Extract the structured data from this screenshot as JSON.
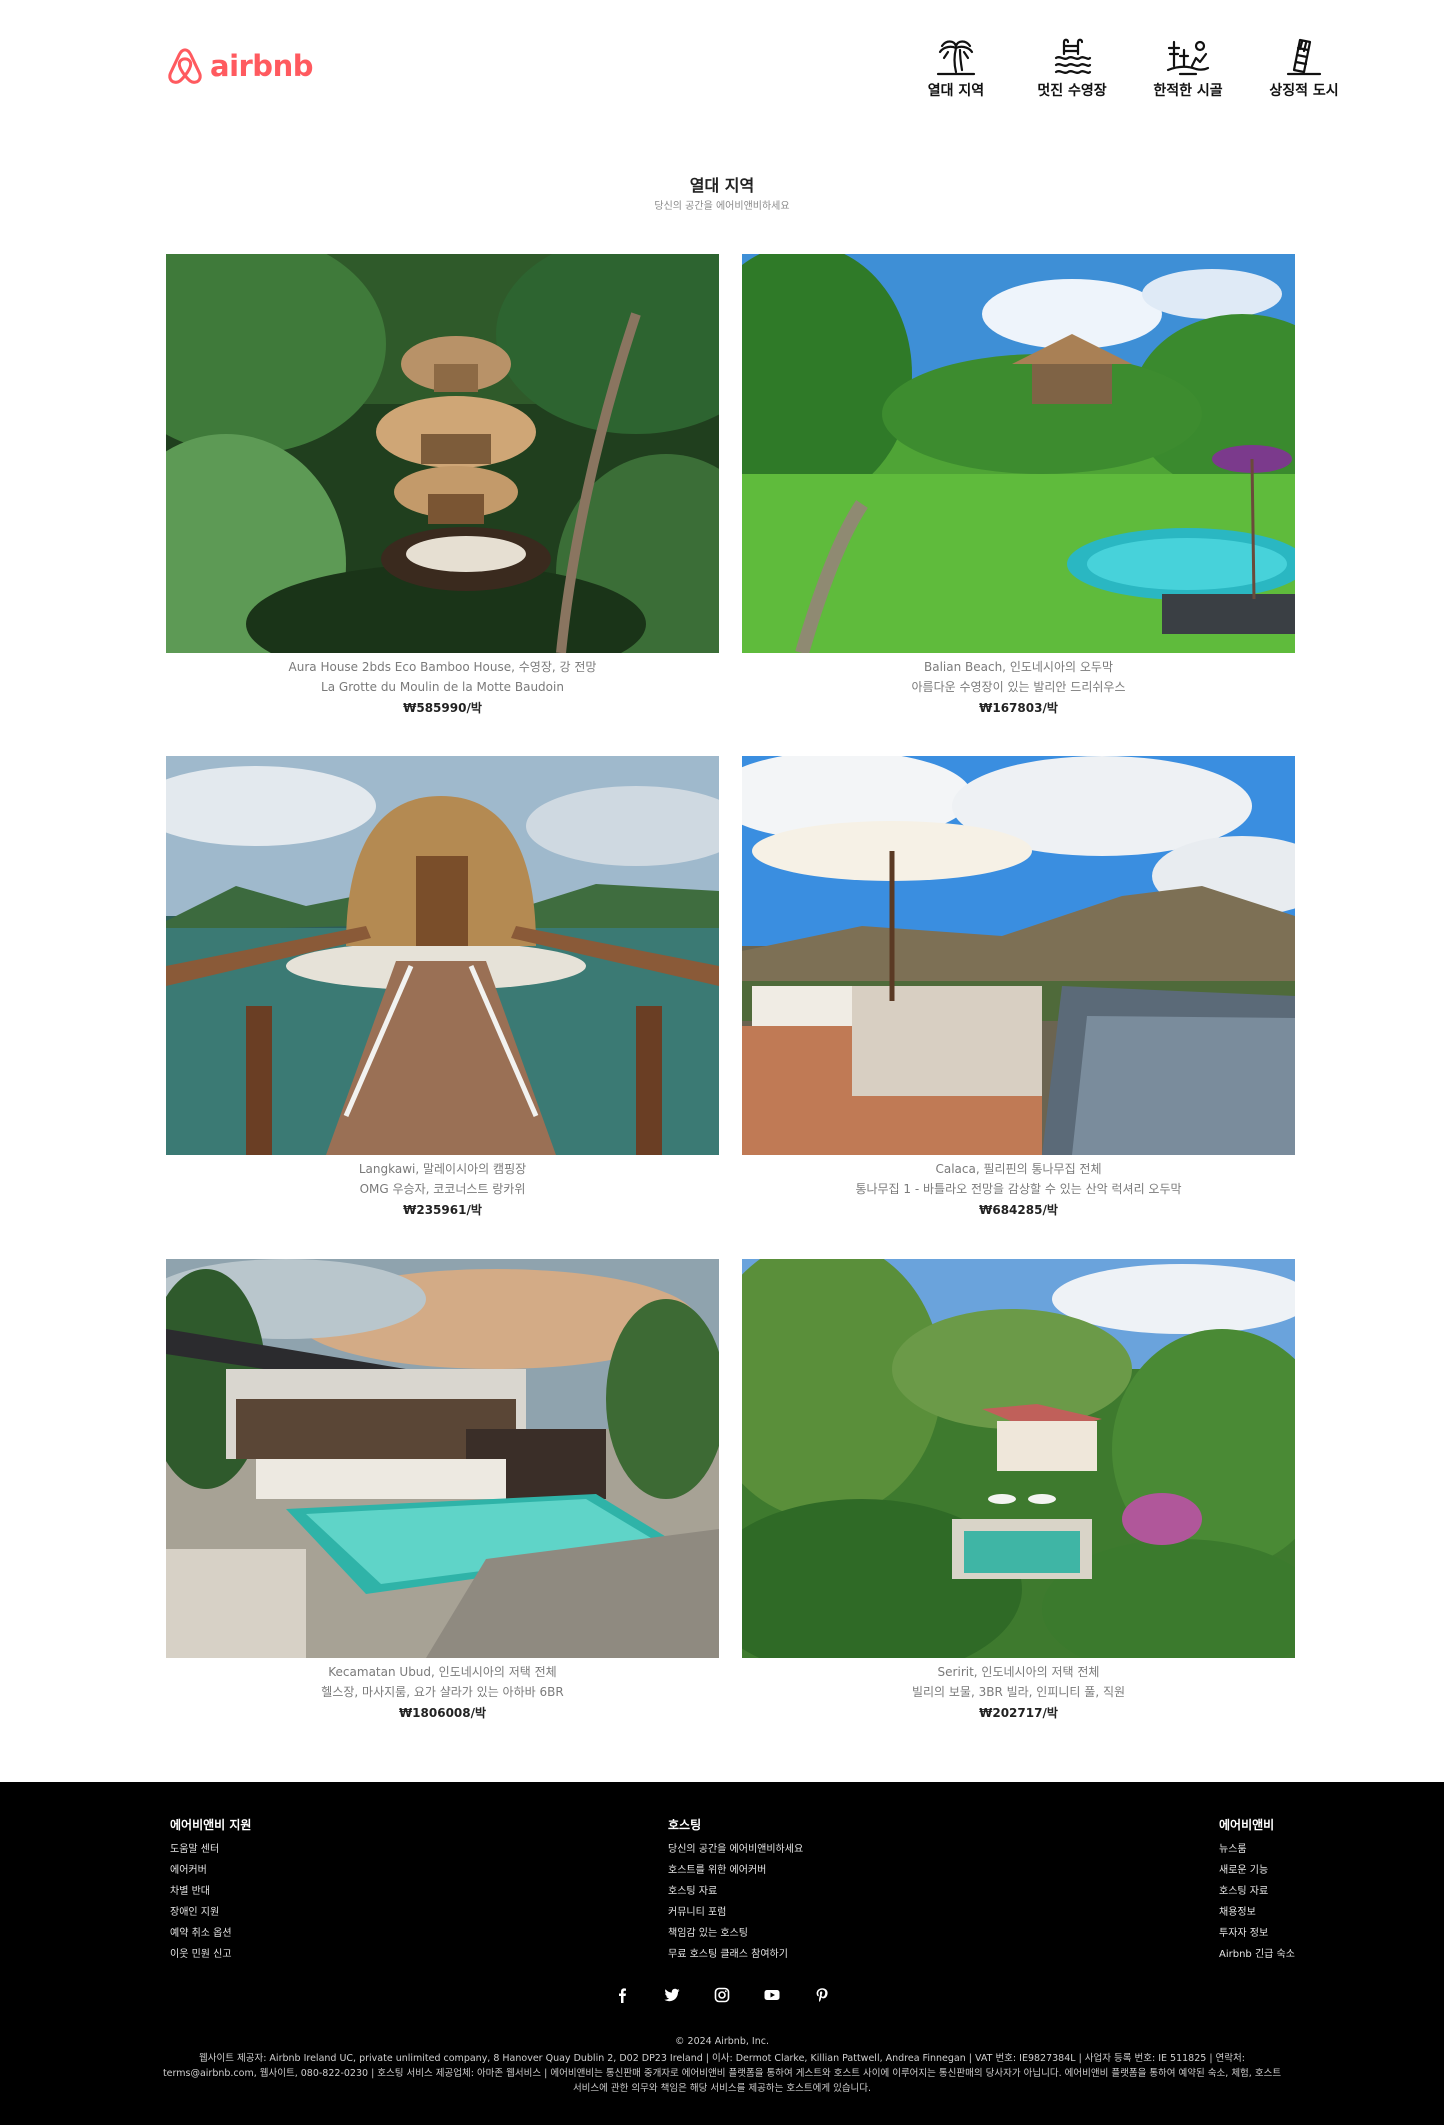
{
  "brand": {
    "name": "airbnb",
    "color": "#FF5A5F"
  },
  "categories": [
    {
      "label": "열대 지역",
      "icon": "palm-tree-icon"
    },
    {
      "label": "멋진 수영장",
      "icon": "pool-icon"
    },
    {
      "label": "한적한 시골",
      "icon": "countryside-icon"
    },
    {
      "label": "상징적 도시",
      "icon": "leaning-tower-icon"
    }
  ],
  "section": {
    "title": "열대 지역",
    "subtitle": "당신의 공간을 에어비앤비하세요"
  },
  "listings": [
    {
      "location": "Aura House 2bds Eco Bamboo House, 수영장, 강 전망",
      "name": "La Grotte du Moulin de la Motte Baudoin",
      "price": "₩585990/박",
      "image": "bamboo-treehouse-jungle-photo"
    },
    {
      "location": "Balian Beach, 인도네시아의 오두막",
      "name": "아름다운 수영장이 있는 발리안 드리쉬우스",
      "price": "₩167803/박",
      "image": "garden-hut-pool-photo"
    },
    {
      "location": "Langkawi, 말레이시아의 캠핑장",
      "name": "OMG 우승자, 코코너스트 랑카위",
      "price": "₩235961/박",
      "image": "floating-coconut-hut-photo"
    },
    {
      "location": "Calaca, 필리핀의 통나무집 전체",
      "name": "통나무집 1 - 바틀라오 전망을 감상할 수 있는 산악 럭셔리 오두막",
      "price": "₩684285/박",
      "image": "mountain-view-deck-photo"
    },
    {
      "location": "Kecamatan Ubud, 인도네시아의 저택 전체",
      "name": "헬스장, 마사지룸, 요가 샬라가 있는 아하바 6BR",
      "price": "₩1806008/박",
      "image": "modern-villa-pool-photo"
    },
    {
      "location": "Seririt, 인도네시아의 저택 전체",
      "name": "빌리의 보물, 3BR 빌라, 인피니티 풀, 직원",
      "price": "₩202717/박",
      "image": "jungle-villa-aerial-photo"
    }
  ],
  "footer": {
    "columns": [
      {
        "title": "에어비앤비 지원",
        "links": [
          "도움말 센터",
          "에어커버",
          "차별 반대",
          "장애인 지원",
          "예약 취소 옵션",
          "이웃 민원 신고"
        ]
      },
      {
        "title": "호스팅",
        "links": [
          "당신의 공간을 에어비앤비하세요",
          "호스트를 위한 에어커버",
          "호스팅 자료",
          "커뮤니티 포럼",
          "책임감 있는 호스팅",
          "무료 호스팅 클래스 참여하기"
        ]
      },
      {
        "title": "에어비앤비",
        "links": [
          "뉴스룸",
          "새로운 기능",
          "호스팅 자료",
          "채용정보",
          "투자자 정보",
          "Airbnb 긴급 숙소"
        ]
      }
    ],
    "social": [
      "facebook-icon",
      "twitter-icon",
      "instagram-icon",
      "youtube-icon",
      "pinterest-icon"
    ],
    "copyright": "© 2024 Airbnb, Inc.",
    "legal": "웹사이트 제공자: Airbnb Ireland UC, private unlimited company, 8 Hanover Quay Dublin 2, D02 DP23 Ireland | 이사: Dermot Clarke, Killian Pattwell, Andrea Finnegan | VAT 번호: IE9827384L | 사업자 등록 번호: IE 511825 | 연락처: terms@airbnb.com, 웹사이트, 080-822-0230 | 호스팅 서비스 제공업체: 아마존 웹서비스 | 에어비앤비는 통신판매 중개자로 에어비앤비 플랫폼을 통하여 게스트와 호스트 사이에 이루어지는 통신판매의 당사자가 아닙니다. 에어비앤비 플랫폼을 통하여 예약된 숙소, 체험, 호스트 서비스에 관한 의무와 책임은 해당 서비스를 제공하는 호스트에게 있습니다."
  }
}
